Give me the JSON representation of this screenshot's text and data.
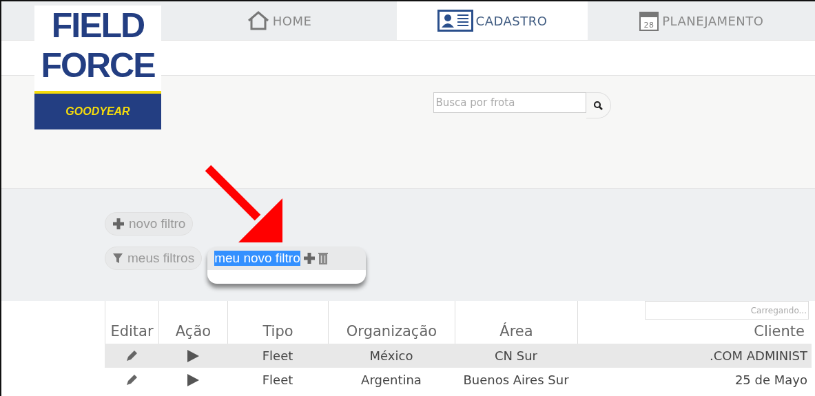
{
  "logo": {
    "line_1": "FIELD",
    "line_2": "FORCE",
    "brand": "GOODYEAR"
  },
  "nav_tabs": [
    {
      "label": "HOME",
      "kind": "home",
      "selected": false
    },
    {
      "label": "CADASTRO",
      "kind": "card",
      "selected": true
    },
    {
      "label": "PLANEJAMENTO",
      "kind": "calendar",
      "icon_text": "28",
      "selected": false
    }
  ],
  "search": {
    "placeholder": "Busca por frota"
  },
  "filters": {
    "new_filter": "novo filtro",
    "my_filters": "meus filtros",
    "editing": {
      "value": "meu novo filtro",
      "selected": true
    }
  },
  "table": {
    "filter_placeholder": "Carregando...",
    "columns": [
      "Editar",
      "Ação",
      "Tipo",
      "Organização",
      "Área",
      "Cliente"
    ],
    "rows": [
      {
        "tipo": "Fleet",
        "organizacao": "México",
        "area": "CN Sur",
        "cliente": ".COM ADMINIST",
        "selected": true
      },
      {
        "tipo": "Fleet",
        "organizacao": "Argentina",
        "area": "Buenos Aires Sur",
        "cliente": "25 de Mayo",
        "selected": false
      }
    ]
  }
}
